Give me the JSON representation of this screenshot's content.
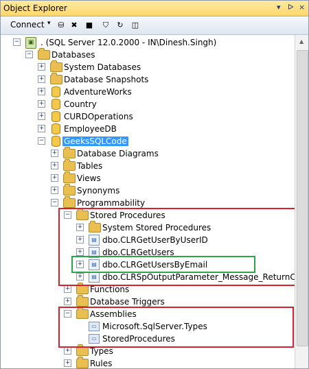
{
  "window": {
    "title": "Object Explorer",
    "controls": [
      "▾",
      "ᐅ",
      "×"
    ]
  },
  "toolbar": {
    "connect_label": "Connect",
    "caret": "▾"
  },
  "tree": {
    "server": ". (SQL Server 12.0.2000 - IN\\Dinesh.Singh)",
    "databases": "Databases",
    "system_databases": "System Databases",
    "database_snapshots": "Database Snapshots",
    "adventureworks": "AdventureWorks",
    "country": "Country",
    "curdoperations": "CURDOperations",
    "employeedb": "EmployeeDB",
    "geekssqlcode": "GeeksSQLCode",
    "database_diagrams": "Database Diagrams",
    "tables": "Tables",
    "views": "Views",
    "synonyms": "Synonyms",
    "programmability": "Programmability",
    "stored_procedures": "Stored Procedures",
    "system_stored_procedures": "System Stored Procedures",
    "proc1": "dbo.CLRGetUserByUserID",
    "proc2": "dbo.CLRGetUsers",
    "proc3": "dbo.CLRGetUsersByEmail",
    "proc4": "dbo.CLRSpOutputParameter_Message_ReturnCode",
    "functions": "Functions",
    "database_triggers": "Database Triggers",
    "assemblies": "Assemblies",
    "assembly1": "Microsoft.SqlServer.Types",
    "assembly2": "StoredProcedures",
    "types": "Types",
    "rules": "Rules"
  },
  "expanders": {
    "plus": "+",
    "minus": "−"
  },
  "colors": {
    "title_bg": "#ffd86a",
    "selection": "#3399ff",
    "highlight_red": "#d4212c",
    "highlight_green": "#2fa34a"
  }
}
